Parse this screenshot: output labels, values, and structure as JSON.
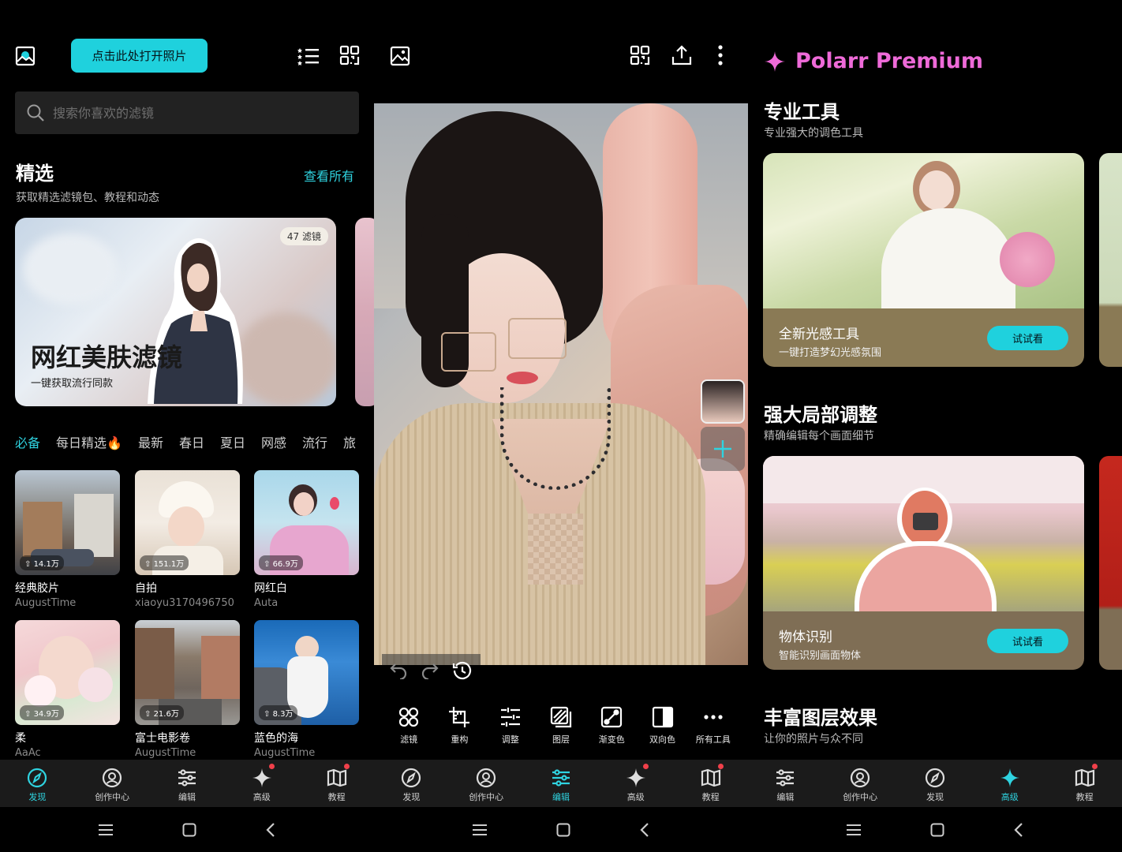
{
  "colors": {
    "accent": "#1fd1dd",
    "premium": "#ee6ad8",
    "notify": "#f0404a"
  },
  "discover": {
    "open_button": "点击此处打开照片",
    "search": {
      "placeholder": "搜索你喜欢的滤镜"
    },
    "section_title": "精选",
    "section_sub": "获取精选滤镜包、教程和动态",
    "see_all": "查看所有",
    "feature": {
      "badge": "47 滤镜",
      "title": "网红美肤滤镜",
      "subtitle": "一键获取流行同款"
    },
    "tabs": [
      "必备",
      "每日精选🔥",
      "最新",
      "春日",
      "夏日",
      "网感",
      "流行",
      "旅"
    ],
    "filters": [
      {
        "name": "经典胶片",
        "author": "AugustTime",
        "count": "14.1万"
      },
      {
        "name": "自拍",
        "author": "xiaoyu3170496750",
        "count": "151.1万"
      },
      {
        "name": "网红白",
        "author": "Auta",
        "count": "66.9万"
      },
      {
        "name": "柔",
        "author": "AaAc",
        "count": "34.9万"
      },
      {
        "name": "富士电影卷",
        "author": "AugustTime",
        "count": "21.6万"
      },
      {
        "name": "蓝色的海",
        "author": "AugustTime",
        "count": "8.3万"
      }
    ],
    "nav": [
      {
        "label": "发现",
        "icon": "compass-icon",
        "active": true
      },
      {
        "label": "创作中心",
        "icon": "user-circle-icon"
      },
      {
        "label": "编辑",
        "icon": "sliders-icon"
      },
      {
        "label": "高级",
        "icon": "sparkle-icon",
        "dot": true
      },
      {
        "label": "教程",
        "icon": "book-icon",
        "dot": true
      }
    ]
  },
  "editor": {
    "tools": [
      {
        "label": "滤镜",
        "icon": "filters-icon"
      },
      {
        "label": "重构",
        "icon": "crop-icon"
      },
      {
        "label": "调整",
        "icon": "adjust-icon"
      },
      {
        "label": "图层",
        "icon": "layers-icon"
      },
      {
        "label": "渐变色",
        "icon": "gradient-icon"
      },
      {
        "label": "双向色",
        "icon": "duotone-icon"
      },
      {
        "label": "所有工具",
        "icon": "more-icon"
      }
    ],
    "nav": [
      {
        "label": "发现",
        "icon": "compass-icon"
      },
      {
        "label": "创作中心",
        "icon": "user-circle-icon"
      },
      {
        "label": "编辑",
        "icon": "sliders-icon",
        "active": true
      },
      {
        "label": "高级",
        "icon": "sparkle-icon",
        "dot": true
      },
      {
        "label": "教程",
        "icon": "book-icon",
        "dot": true
      }
    ]
  },
  "premium": {
    "title": "Polarr Premium",
    "sections": [
      {
        "title": "专业工具",
        "sub": "专业强大的调色工具",
        "card_title": "全新光感工具",
        "card_sub": "一键打造梦幻光感氛围",
        "button": "试试看"
      },
      {
        "title": "强大局部调整",
        "sub": "精确编辑每个画面细节",
        "card_title": "物体识别",
        "card_sub": "智能识别画面物体",
        "button": "试试看"
      },
      {
        "title": "丰富图层效果",
        "sub": "让你的照片与众不同"
      }
    ],
    "nav": [
      {
        "label": "编辑",
        "icon": "sliders-icon"
      },
      {
        "label": "创作中心",
        "icon": "user-circle-icon"
      },
      {
        "label": "发现",
        "icon": "compass-icon"
      },
      {
        "label": "高级",
        "icon": "sparkle-icon",
        "active": true
      },
      {
        "label": "教程",
        "icon": "book-icon",
        "dot": true
      }
    ]
  }
}
